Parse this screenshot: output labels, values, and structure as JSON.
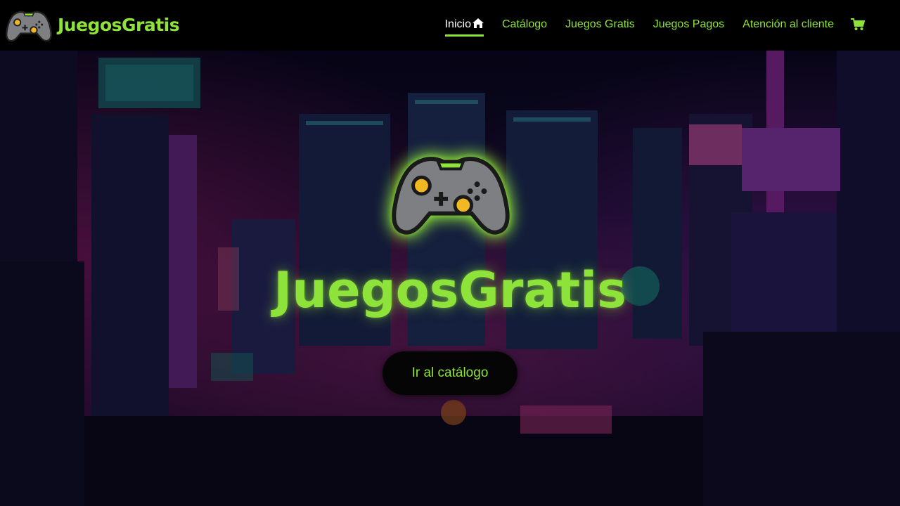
{
  "brand": {
    "name": "JuegosGratis",
    "icon": "gamepad-icon"
  },
  "nav": {
    "items": [
      {
        "label": "Inicio",
        "active": true,
        "icon": "home-icon"
      },
      {
        "label": "Catálogo",
        "active": false
      },
      {
        "label": "Juegos Gratis",
        "active": false
      },
      {
        "label": "Juegos Pagos",
        "active": false
      },
      {
        "label": "Atención al cliente",
        "active": false
      }
    ],
    "cart_icon": "cart-icon"
  },
  "hero": {
    "title": "JuegosGratis",
    "cta_label": "Ir al catálogo",
    "logo_icon": "gamepad-icon",
    "background": "pixel-art-cyberpunk-city"
  },
  "colors": {
    "accent": "#8ee33a",
    "nav_bg": "#000000",
    "active_text": "#ffffff"
  }
}
